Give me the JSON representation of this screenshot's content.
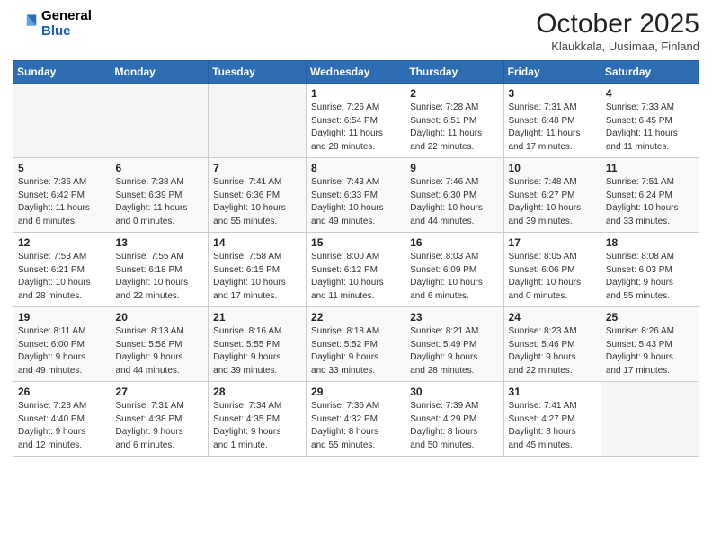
{
  "header": {
    "logo_line1": "General",
    "logo_line2": "Blue",
    "month": "October 2025",
    "location": "Klaukkala, Uusimaa, Finland"
  },
  "weekdays": [
    "Sunday",
    "Monday",
    "Tuesday",
    "Wednesday",
    "Thursday",
    "Friday",
    "Saturday"
  ],
  "weeks": [
    [
      {
        "day": "",
        "info": ""
      },
      {
        "day": "",
        "info": ""
      },
      {
        "day": "",
        "info": ""
      },
      {
        "day": "1",
        "info": "Sunrise: 7:26 AM\nSunset: 6:54 PM\nDaylight: 11 hours\nand 28 minutes."
      },
      {
        "day": "2",
        "info": "Sunrise: 7:28 AM\nSunset: 6:51 PM\nDaylight: 11 hours\nand 22 minutes."
      },
      {
        "day": "3",
        "info": "Sunrise: 7:31 AM\nSunset: 6:48 PM\nDaylight: 11 hours\nand 17 minutes."
      },
      {
        "day": "4",
        "info": "Sunrise: 7:33 AM\nSunset: 6:45 PM\nDaylight: 11 hours\nand 11 minutes."
      }
    ],
    [
      {
        "day": "5",
        "info": "Sunrise: 7:36 AM\nSunset: 6:42 PM\nDaylight: 11 hours\nand 6 minutes."
      },
      {
        "day": "6",
        "info": "Sunrise: 7:38 AM\nSunset: 6:39 PM\nDaylight: 11 hours\nand 0 minutes."
      },
      {
        "day": "7",
        "info": "Sunrise: 7:41 AM\nSunset: 6:36 PM\nDaylight: 10 hours\nand 55 minutes."
      },
      {
        "day": "8",
        "info": "Sunrise: 7:43 AM\nSunset: 6:33 PM\nDaylight: 10 hours\nand 49 minutes."
      },
      {
        "day": "9",
        "info": "Sunrise: 7:46 AM\nSunset: 6:30 PM\nDaylight: 10 hours\nand 44 minutes."
      },
      {
        "day": "10",
        "info": "Sunrise: 7:48 AM\nSunset: 6:27 PM\nDaylight: 10 hours\nand 39 minutes."
      },
      {
        "day": "11",
        "info": "Sunrise: 7:51 AM\nSunset: 6:24 PM\nDaylight: 10 hours\nand 33 minutes."
      }
    ],
    [
      {
        "day": "12",
        "info": "Sunrise: 7:53 AM\nSunset: 6:21 PM\nDaylight: 10 hours\nand 28 minutes."
      },
      {
        "day": "13",
        "info": "Sunrise: 7:55 AM\nSunset: 6:18 PM\nDaylight: 10 hours\nand 22 minutes."
      },
      {
        "day": "14",
        "info": "Sunrise: 7:58 AM\nSunset: 6:15 PM\nDaylight: 10 hours\nand 17 minutes."
      },
      {
        "day": "15",
        "info": "Sunrise: 8:00 AM\nSunset: 6:12 PM\nDaylight: 10 hours\nand 11 minutes."
      },
      {
        "day": "16",
        "info": "Sunrise: 8:03 AM\nSunset: 6:09 PM\nDaylight: 10 hours\nand 6 minutes."
      },
      {
        "day": "17",
        "info": "Sunrise: 8:05 AM\nSunset: 6:06 PM\nDaylight: 10 hours\nand 0 minutes."
      },
      {
        "day": "18",
        "info": "Sunrise: 8:08 AM\nSunset: 6:03 PM\nDaylight: 9 hours\nand 55 minutes."
      }
    ],
    [
      {
        "day": "19",
        "info": "Sunrise: 8:11 AM\nSunset: 6:00 PM\nDaylight: 9 hours\nand 49 minutes."
      },
      {
        "day": "20",
        "info": "Sunrise: 8:13 AM\nSunset: 5:58 PM\nDaylight: 9 hours\nand 44 minutes."
      },
      {
        "day": "21",
        "info": "Sunrise: 8:16 AM\nSunset: 5:55 PM\nDaylight: 9 hours\nand 39 minutes."
      },
      {
        "day": "22",
        "info": "Sunrise: 8:18 AM\nSunset: 5:52 PM\nDaylight: 9 hours\nand 33 minutes."
      },
      {
        "day": "23",
        "info": "Sunrise: 8:21 AM\nSunset: 5:49 PM\nDaylight: 9 hours\nand 28 minutes."
      },
      {
        "day": "24",
        "info": "Sunrise: 8:23 AM\nSunset: 5:46 PM\nDaylight: 9 hours\nand 22 minutes."
      },
      {
        "day": "25",
        "info": "Sunrise: 8:26 AM\nSunset: 5:43 PM\nDaylight: 9 hours\nand 17 minutes."
      }
    ],
    [
      {
        "day": "26",
        "info": "Sunrise: 7:28 AM\nSunset: 4:40 PM\nDaylight: 9 hours\nand 12 minutes."
      },
      {
        "day": "27",
        "info": "Sunrise: 7:31 AM\nSunset: 4:38 PM\nDaylight: 9 hours\nand 6 minutes."
      },
      {
        "day": "28",
        "info": "Sunrise: 7:34 AM\nSunset: 4:35 PM\nDaylight: 9 hours\nand 1 minute."
      },
      {
        "day": "29",
        "info": "Sunrise: 7:36 AM\nSunset: 4:32 PM\nDaylight: 8 hours\nand 55 minutes."
      },
      {
        "day": "30",
        "info": "Sunrise: 7:39 AM\nSunset: 4:29 PM\nDaylight: 8 hours\nand 50 minutes."
      },
      {
        "day": "31",
        "info": "Sunrise: 7:41 AM\nSunset: 4:27 PM\nDaylight: 8 hours\nand 45 minutes."
      },
      {
        "day": "",
        "info": ""
      }
    ]
  ]
}
